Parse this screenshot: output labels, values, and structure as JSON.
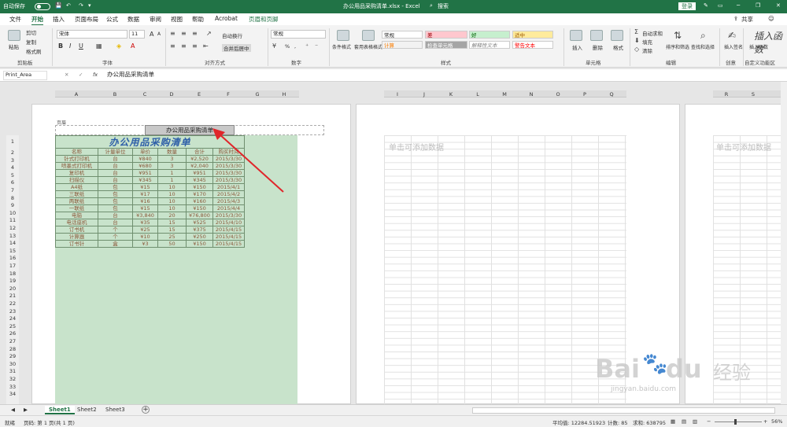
{
  "colors": {
    "accent": "#217346",
    "table_text": "#8b5a3c",
    "title_text": "#2e5fa8",
    "print_area_fill": "#c8e3cb"
  },
  "titlebar": {
    "autosave_label": "自动保存",
    "autosave_state": "关",
    "window_title": "办公用品采购清单.xlsx - Excel",
    "login_label": "登录",
    "share_label": "共享",
    "search_label": "搜索"
  },
  "tabs": [
    "文件",
    "开始",
    "插入",
    "页面布局",
    "公式",
    "数据",
    "审阅",
    "视图",
    "帮助",
    "Acrobat",
    "页眉和页脚"
  ],
  "ribbon": {
    "clipboard": {
      "group": "剪贴板",
      "paste": "粘贴",
      "cut": "剪切",
      "copy": "复制",
      "format_painter": "格式刷"
    },
    "font": {
      "group": "字体",
      "font_name": "宋体",
      "font_size": "11",
      "bold": "B",
      "italic": "I",
      "underline": "U",
      "grow": "A",
      "shrink": "A"
    },
    "alignment": {
      "group": "对齐方式",
      "wrap": "自动换行",
      "merge": "合并后居中"
    },
    "number": {
      "group": "数字",
      "format": "常规",
      "percent": "%",
      "comma": ","
    },
    "styles": {
      "group": "样式",
      "cond_format": "条件格式",
      "table_format": "套用表格格式",
      "cells": [
        [
          "常规",
          "差",
          "好",
          "适中"
        ],
        [
          "计算",
          "检查单元格",
          "解释性文本",
          "警告文本"
        ]
      ]
    },
    "cells_group": {
      "group": "单元格",
      "insert": "插入",
      "delete": "删除",
      "format": "格式"
    },
    "editing": {
      "group": "编辑",
      "autosum": "自动求和",
      "fill": "填充",
      "clear": "清除",
      "sort": "排序和筛选",
      "find": "查找和选择"
    },
    "creative": {
      "group": "创意",
      "sign": "插入签名"
    },
    "custom": {
      "group": "自定义功能区",
      "fx": "插入函数"
    }
  },
  "formula_bar": {
    "name_box": "Print_Area",
    "cancel": "✕",
    "enter": "✓",
    "fx": "fx",
    "content": "办公用品采购清单"
  },
  "page1": {
    "header_label": "页眉",
    "header_text": "办公用品采购清单",
    "columns": [
      "A",
      "B",
      "C",
      "D",
      "E",
      "F",
      "G",
      "H"
    ]
  },
  "page2": {
    "columns": [
      "I",
      "J",
      "K",
      "L",
      "M",
      "N",
      "O",
      "P",
      "Q"
    ],
    "placeholder": "单击可添加数据"
  },
  "page3": {
    "columns": [
      "R",
      "S"
    ],
    "placeholder": "单击可添加数据"
  },
  "rows": [
    "1",
    "2",
    "3",
    "4",
    "5",
    "6",
    "7",
    "8",
    "9",
    "10",
    "11",
    "12",
    "13",
    "14",
    "15",
    "16",
    "17",
    "18",
    "19",
    "20",
    "21",
    "22",
    "23",
    "24",
    "25",
    "26",
    "27",
    "28",
    "29",
    "30",
    "31",
    "32",
    "33",
    "34"
  ],
  "table": {
    "title": "办公用品采购清单",
    "headers": [
      "名称",
      "计量单位",
      "单价",
      "数量",
      "合计",
      "购买时间"
    ],
    "rows": [
      [
        "针式打印机",
        "台",
        "¥840",
        "3",
        "¥2,520",
        "2015/3/30"
      ],
      [
        "喷墨式打印机",
        "台",
        "¥680",
        "3",
        "¥2,040",
        "2015/3/30"
      ],
      [
        "复印机",
        "台",
        "¥951",
        "1",
        "¥951",
        "2015/3/30"
      ],
      [
        "扫描仪",
        "台",
        "¥345",
        "1",
        "¥345",
        "2015/3/30"
      ],
      [
        "A4纸",
        "包",
        "¥15",
        "10",
        "¥150",
        "2015/4/1"
      ],
      [
        "三联纸",
        "包",
        "¥17",
        "10",
        "¥170",
        "2015/4/2"
      ],
      [
        "两联纸",
        "包",
        "¥16",
        "10",
        "¥160",
        "2015/4/3"
      ],
      [
        "一联纸",
        "包",
        "¥15",
        "10",
        "¥150",
        "2015/4/4"
      ],
      [
        "电脑",
        "台",
        "¥3,840",
        "20",
        "¥76,800",
        "2015/3/30"
      ],
      [
        "电话座机",
        "台",
        "¥35",
        "15",
        "¥525",
        "2015/4/10"
      ],
      [
        "订书机",
        "个",
        "¥25",
        "15",
        "¥375",
        "2015/4/15"
      ],
      [
        "计算器",
        "个",
        "¥10",
        "25",
        "¥250",
        "2015/4/15"
      ],
      [
        "订书针",
        "盒",
        "¥3",
        "50",
        "¥150",
        "2015/4/15"
      ]
    ]
  },
  "sheets": [
    "Sheet1",
    "Sheet2",
    "Sheet3"
  ],
  "add_sheet": "+",
  "status": {
    "ready": "就绪",
    "page": "页码: 第 1 页(共 1 页)",
    "average": "平均值: 12284.51923",
    "count": "计数: 85",
    "sum": "求和: 638795",
    "zoom": "56%"
  },
  "watermark": {
    "brand": "Bai",
    "brand2": "du",
    "cn": "经验",
    "url": "jingyan.baidu.com"
  }
}
